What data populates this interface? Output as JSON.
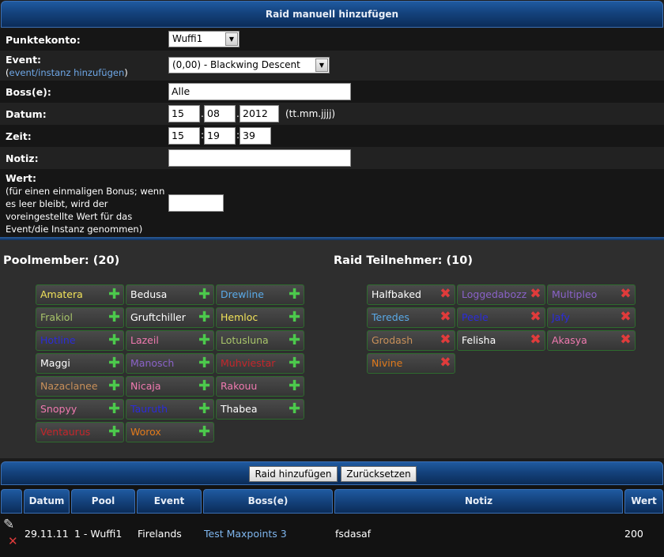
{
  "title": "Raid manuell hinzufügen",
  "form": {
    "account_label": "Punktekonto:",
    "account_value": "Wuffi1",
    "event_label": "Event:",
    "event_link": "event/instanz hinzufügen",
    "event_value": "(0,00) - Blackwing Descent",
    "boss_label": "Boss(e):",
    "boss_value": "Alle",
    "date_label": "Datum:",
    "date_day": "15",
    "date_month": "08",
    "date_year": "2012",
    "date_hint": "(tt.mm.jjjj)",
    "time_label": "Zeit:",
    "time_h": "15",
    "time_m": "19",
    "time_s": "39",
    "note_label": "Notiz:",
    "note_value": "",
    "value_label": "Wert:",
    "value_desc": "(für einen einmaligen Bonus; wenn es leer bleibt, wird der voreingestellte Wert für das Event/die Instanz genommen)",
    "value_value": ""
  },
  "pool": {
    "title": "Poolmember: (20)",
    "members": [
      {
        "name": "Amatera",
        "color": "#f2e35a"
      },
      {
        "name": "Bedusa",
        "color": "#ffffff"
      },
      {
        "name": "Drewline",
        "color": "#5aaae8"
      },
      {
        "name": "Frakiol",
        "color": "#a8c46a"
      },
      {
        "name": "Gruftchiller",
        "color": "#ffffff"
      },
      {
        "name": "Hemloc",
        "color": "#f2e35a"
      },
      {
        "name": "Hotline",
        "color": "#2b2bd8"
      },
      {
        "name": "Lazeil",
        "color": "#f07ab0"
      },
      {
        "name": "Lotusluna",
        "color": "#a8c46a"
      },
      {
        "name": "Maggi",
        "color": "#ffffff"
      },
      {
        "name": "Manosch",
        "color": "#8a62c8"
      },
      {
        "name": "Muhviestar",
        "color": "#c4262b"
      },
      {
        "name": "Nazaclanee",
        "color": "#c8905a"
      },
      {
        "name": "Nicaja",
        "color": "#f07ab0"
      },
      {
        "name": "Rakouu",
        "color": "#f07ab0"
      },
      {
        "name": "Snopyy",
        "color": "#f07ab0"
      },
      {
        "name": "Tauruth",
        "color": "#2b2bd8"
      },
      {
        "name": "Thabea",
        "color": "#ffffff"
      },
      {
        "name": "Ventaurus",
        "color": "#c4262b"
      },
      {
        "name": "Worox",
        "color": "#e07a1c"
      }
    ]
  },
  "raid": {
    "title": "Raid Teilnehmer: (10)",
    "members": [
      {
        "name": "Halfbaked",
        "color": "#ffffff"
      },
      {
        "name": "Loggedabozz",
        "color": "#8a62c8"
      },
      {
        "name": "Multipleo",
        "color": "#8a62c8"
      },
      {
        "name": "Teredes",
        "color": "#5aaae8"
      },
      {
        "name": "Peele",
        "color": "#2b2bd8"
      },
      {
        "name": "Jafy",
        "color": "#2b2bd8"
      },
      {
        "name": "Grodash",
        "color": "#c8905a"
      },
      {
        "name": "Felisha",
        "color": "#ffffff"
      },
      {
        "name": "Akasya",
        "color": "#f07ab0"
      },
      {
        "name": "Nivine",
        "color": "#e07a1c"
      }
    ]
  },
  "buttons": {
    "add": "Raid hinzufügen",
    "reset": "Zurücksetzen"
  },
  "table": {
    "headers": [
      "Datum",
      "Pool",
      "Event",
      "Boss(e)",
      "Notiz",
      "Wert"
    ],
    "rows": [
      {
        "date": "29.11.11",
        "pool": "1 - Wuffi1",
        "event": "Firelands",
        "boss": "Test Maxpoints 3",
        "note": "fsdasaf",
        "value": "200"
      }
    ]
  }
}
